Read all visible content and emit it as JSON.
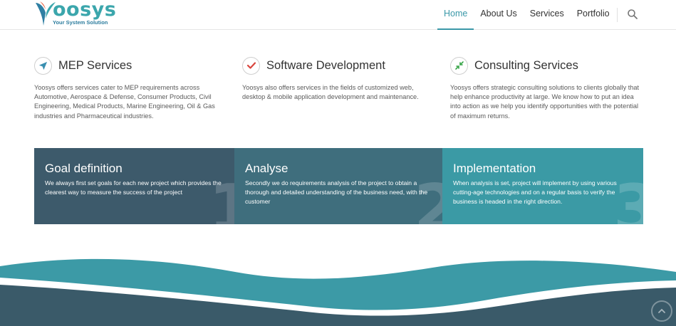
{
  "brand": {
    "name": "oosys",
    "tagline": "Your System Solution",
    "primary_color": "#3ba6ac",
    "tagline_color": "#2d7d9e"
  },
  "nav": {
    "items": [
      {
        "label": "Home",
        "active": true
      },
      {
        "label": "About Us",
        "active": false
      },
      {
        "label": "Services",
        "active": false
      },
      {
        "label": "Portfolio",
        "active": false
      }
    ],
    "search_icon": "search-icon"
  },
  "services": [
    {
      "icon": "navigation-arrow-icon",
      "title": "MEP Services",
      "desc": "Yoosys offers services cater to MEP requirements across Automotive, Aerospace & Defense, Consumer Products, Civil Engineering, Medical Products, Marine Engineering, Oil & Gas industries and Pharmaceutical industries."
    },
    {
      "icon": "check-icon",
      "title": "Software Development",
      "desc": "Yoosys also offers services in the fields of customized web, desktop & mobile application development and maintenance."
    },
    {
      "icon": "compress-arrows-icon",
      "title": "Consulting Services",
      "desc": "Yoosys offers strategic consulting solutions to clients globally that help enhance productivity at large. We know how to put an idea into action as we help you identify opportunities with the potential of maximum returns."
    }
  ],
  "process": [
    {
      "number": "1",
      "title": "Goal definition",
      "desc": "We always first set goals for each new project which provides the clearest way to measure the success of the project",
      "color": "#3d5a6b"
    },
    {
      "number": "2",
      "title": "Analyse",
      "desc": "Secondly we do requirements analysis of the project to obtain a thorough and detailed understanding of the business need, with the customer",
      "color": "#3f6e7d"
    },
    {
      "number": "3",
      "title": "Implementation",
      "desc": "When analysis is set, project will implement by using various cutting-age technologies and on a regular basis to verify the business is headed in the right direction.",
      "color": "#3b9aa5"
    }
  ],
  "footer": {
    "wave_light": "#3c9aa6",
    "wave_dark": "#3a5a69",
    "scroll_top_icon": "chevron-up-circle-icon"
  }
}
